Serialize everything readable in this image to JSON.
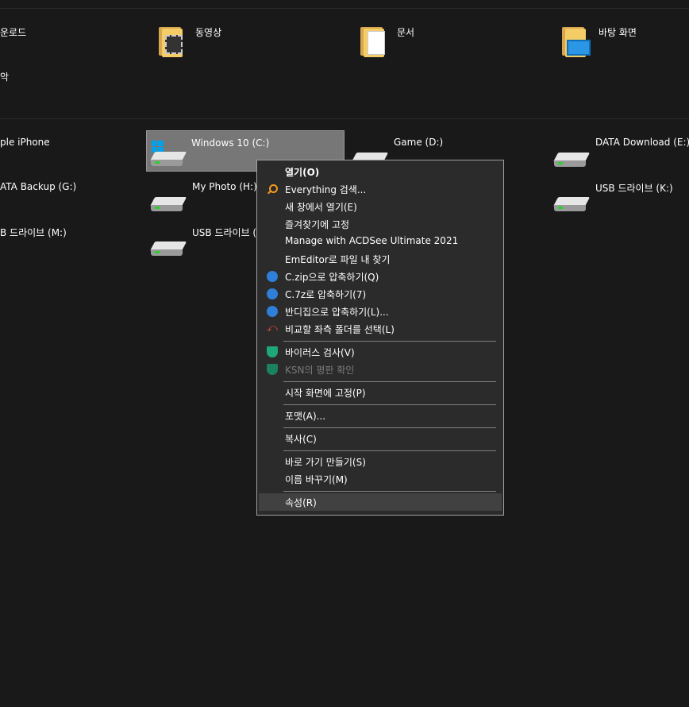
{
  "folders": [
    {
      "label": "운로드",
      "icon": "downloads-folder-icon"
    },
    {
      "label": "동영상",
      "icon": "videos-folder-icon"
    },
    {
      "label": "문서",
      "icon": "documents-folder-icon"
    },
    {
      "label": "바탕 화면",
      "icon": "desktop-folder-icon"
    },
    {
      "label": "악",
      "icon": "music-folder-icon"
    }
  ],
  "drives": [
    {
      "label": "ple iPhone",
      "icon": "iphone-icon"
    },
    {
      "label": "Windows 10 (C:)",
      "icon": "windows-drive-icon",
      "selected": true
    },
    {
      "label": "Game (D:)",
      "icon": "drive-icon"
    },
    {
      "label": "DATA Download (E:)",
      "icon": "drive-icon"
    },
    {
      "label": "ATA Backup (G:)",
      "icon": "drive-icon"
    },
    {
      "label": "My Photo (H:)",
      "icon": "drive-icon"
    },
    {
      "label": "USB 드라이브 (K:)",
      "icon": "drive-icon"
    },
    {
      "label": "B 드라이브 (M:)",
      "icon": "drive-icon"
    },
    {
      "label": "USB 드라이브 (",
      "icon": "drive-icon"
    }
  ],
  "context_menu": {
    "items": [
      {
        "label": "열기(O)",
        "bold": true
      },
      {
        "label": "Everything 검색...",
        "icon": "search-icon"
      },
      {
        "label": "새 창에서 열기(E)"
      },
      {
        "label": "즐겨찾기에 고정"
      },
      {
        "label": "Manage with ACDSee Ultimate 2021"
      },
      {
        "label": "EmEditor로 파일 내 찾기"
      },
      {
        "label": "C.zip으로 압축하기(Q)",
        "icon": "bandizip-icon"
      },
      {
        "label": "C.7z로 압축하기(7)",
        "icon": "bandizip-icon"
      },
      {
        "label": "반디집으로 압축하기(L)...",
        "icon": "bandizip-icon"
      },
      {
        "label": "비교할 좌측 폴더를 선택(L)",
        "icon": "compare-icon"
      },
      {
        "label": "바이러스 검사(V)",
        "icon": "kaspersky-shield-icon"
      },
      {
        "label": "KSN의 평판 확인",
        "icon": "kaspersky-shield-icon",
        "disabled": true
      },
      {
        "label": "시작 화면에 고정(P)"
      },
      {
        "label": "포맷(A)..."
      },
      {
        "label": "복사(C)"
      },
      {
        "label": "바로 가기 만들기(S)"
      },
      {
        "label": "이름 바꾸기(M)"
      },
      {
        "label": "속성(R)",
        "hover": true
      }
    ]
  },
  "colors": {
    "background": "#191919",
    "menu_background": "#2b2b2b",
    "selection": "#777777",
    "windows_blue": "#00a2ed"
  }
}
